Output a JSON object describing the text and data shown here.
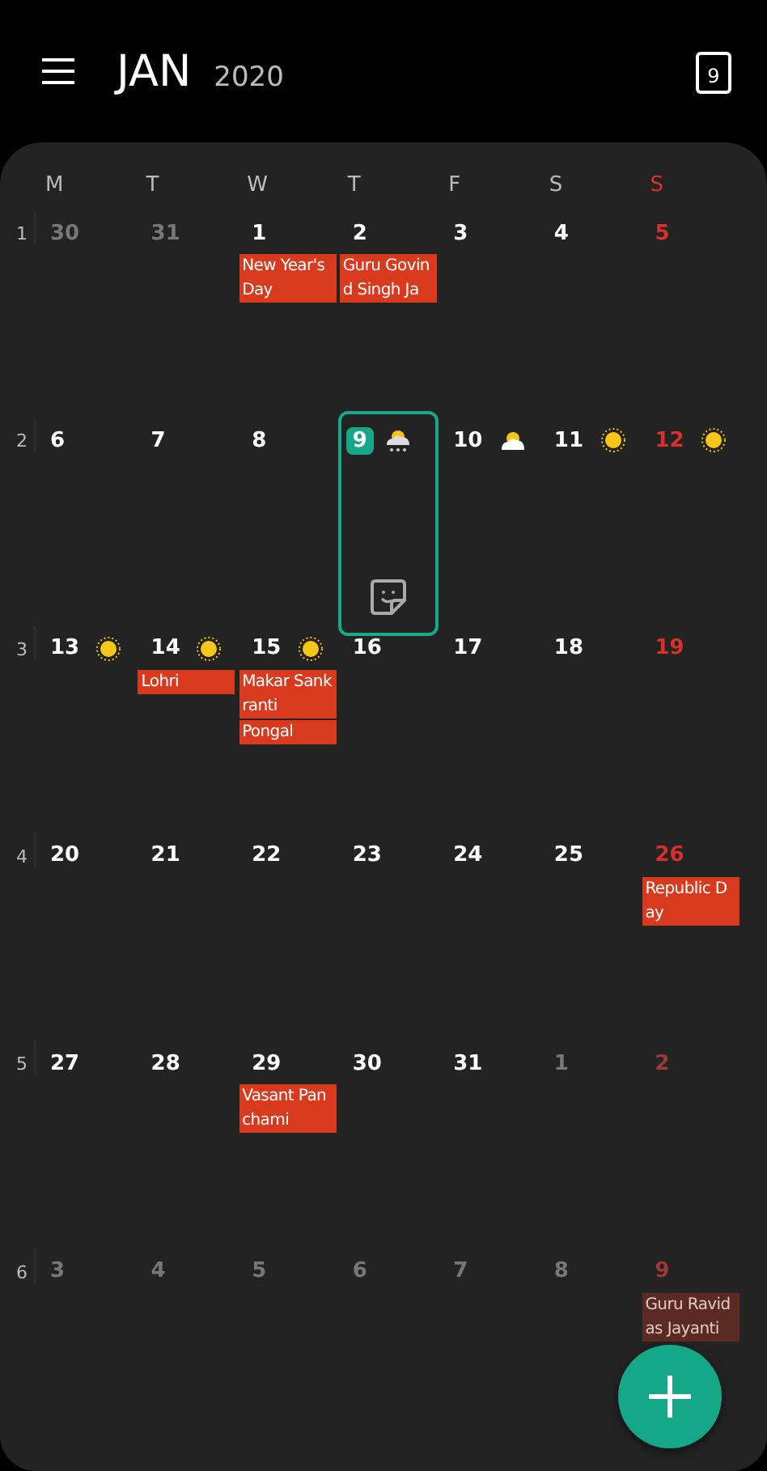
{
  "header": {
    "month": "JAN",
    "year": "2020",
    "today_icon_day": "9"
  },
  "weekdays": [
    {
      "label": "M",
      "red": false
    },
    {
      "label": "T",
      "red": false
    },
    {
      "label": "W",
      "red": false
    },
    {
      "label": "T",
      "red": false
    },
    {
      "label": "F",
      "red": false
    },
    {
      "label": "S",
      "red": false
    },
    {
      "label": "S",
      "red": true
    }
  ],
  "weeks": [
    {
      "number": "1",
      "days": [
        {
          "date": "30",
          "in_month": false
        },
        {
          "date": "31",
          "in_month": false
        },
        {
          "date": "1",
          "in_month": true,
          "events": [
            "New Year's Day"
          ]
        },
        {
          "date": "2",
          "in_month": true,
          "events": [
            "Guru Govind Singh Ja"
          ]
        },
        {
          "date": "3",
          "in_month": true
        },
        {
          "date": "4",
          "in_month": true
        },
        {
          "date": "5",
          "in_month": true,
          "red": true
        }
      ]
    },
    {
      "number": "2",
      "days": [
        {
          "date": "6",
          "in_month": true
        },
        {
          "date": "7",
          "in_month": true
        },
        {
          "date": "8",
          "in_month": true
        },
        {
          "date": "9",
          "in_month": true,
          "selected": true,
          "weather": {
            "kind": "rain"
          },
          "sticker": true
        },
        {
          "date": "10",
          "in_month": true,
          "weather": {
            "kind": "cloudy"
          }
        },
        {
          "date": "11",
          "in_month": true,
          "weather": {
            "kind": "sunny"
          }
        },
        {
          "date": "12",
          "in_month": true,
          "red": true,
          "weather": {
            "kind": "sunny"
          }
        }
      ]
    },
    {
      "number": "3",
      "days": [
        {
          "date": "13",
          "in_month": true,
          "weather": {
            "kind": "sunny"
          }
        },
        {
          "date": "14",
          "in_month": true,
          "weather": {
            "kind": "sunny"
          },
          "events": [
            "Lohri"
          ]
        },
        {
          "date": "15",
          "in_month": true,
          "weather": {
            "kind": "sunny"
          },
          "events": [
            "Makar Sankranti",
            "Pongal"
          ]
        },
        {
          "date": "16",
          "in_month": true
        },
        {
          "date": "17",
          "in_month": true
        },
        {
          "date": "18",
          "in_month": true
        },
        {
          "date": "19",
          "in_month": true,
          "red": true
        }
      ]
    },
    {
      "number": "4",
      "days": [
        {
          "date": "20",
          "in_month": true
        },
        {
          "date": "21",
          "in_month": true
        },
        {
          "date": "22",
          "in_month": true
        },
        {
          "date": "23",
          "in_month": true
        },
        {
          "date": "24",
          "in_month": true
        },
        {
          "date": "25",
          "in_month": true
        },
        {
          "date": "26",
          "in_month": true,
          "red": true,
          "events": [
            "Republic Day"
          ]
        }
      ]
    },
    {
      "number": "5",
      "days": [
        {
          "date": "27",
          "in_month": true
        },
        {
          "date": "28",
          "in_month": true
        },
        {
          "date": "29",
          "in_month": true,
          "events": [
            "Vasant Panchami"
          ]
        },
        {
          "date": "30",
          "in_month": true
        },
        {
          "date": "31",
          "in_month": true
        },
        {
          "date": "1",
          "in_month": false
        },
        {
          "date": "2",
          "in_month": false,
          "red": true
        }
      ]
    },
    {
      "number": "6",
      "days": [
        {
          "date": "3",
          "in_month": false
        },
        {
          "date": "4",
          "in_month": false
        },
        {
          "date": "5",
          "in_month": false
        },
        {
          "date": "6",
          "in_month": false
        },
        {
          "date": "7",
          "in_month": false
        },
        {
          "date": "8",
          "in_month": false
        },
        {
          "date": "9",
          "in_month": false,
          "red": true,
          "events": [
            "Guru Ravidas Jayanti"
          ]
        }
      ]
    }
  ]
}
